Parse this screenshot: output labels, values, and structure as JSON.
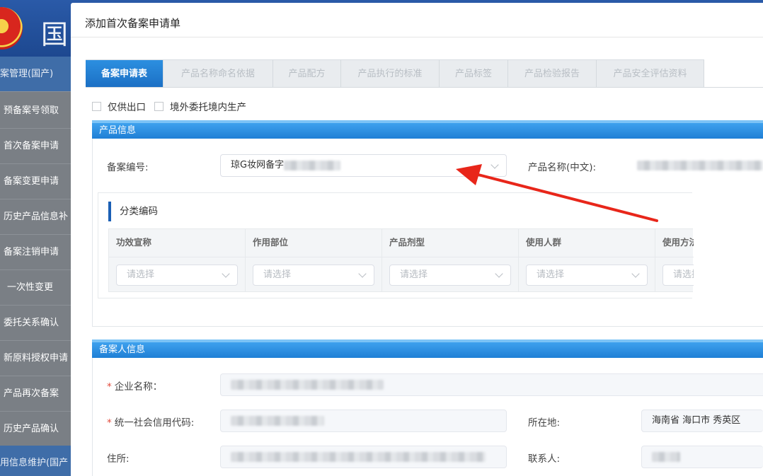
{
  "background": {
    "header_title": "国",
    "menu_group_top": "案管理(国产)",
    "menu_items": [
      "预备案号领取",
      "首次备案申请",
      "备案变更申请",
      "历史产品信息补",
      "备案注销申请",
      "一次性变更",
      "委托关系确认",
      "新原料授权申请",
      "产品再次备案",
      "历史产品确认"
    ],
    "menu_group_bottom": "用信息维护(国产"
  },
  "modal": {
    "title": "添加首次备案申请单",
    "tabs": [
      "备案申请表",
      "产品名称命名依据",
      "产品配方",
      "产品执行的标准",
      "产品标签",
      "产品检验报告",
      "产品安全评估资料"
    ],
    "active_tab": "备案申请表",
    "checkboxes": [
      {
        "label": "仅供出口",
        "checked": false
      },
      {
        "label": "境外委托境内生产",
        "checked": false
      }
    ],
    "product_info": {
      "heading": "产品信息",
      "filing_no_label": "备案编号:",
      "filing_no_value": "琼G妆网备字",
      "product_name_label": "产品名称(中文):",
      "classification": {
        "title": "分类编码",
        "columns": [
          {
            "header": "功效宣称",
            "placeholder": "请选择"
          },
          {
            "header": "作用部位",
            "placeholder": "请选择"
          },
          {
            "header": "产品剂型",
            "placeholder": "请选择"
          },
          {
            "header": "使用人群",
            "placeholder": "请选择"
          },
          {
            "header": "使用方法",
            "placeholder": "请选择"
          }
        ]
      }
    },
    "applicant_info": {
      "heading": "备案人信息",
      "company_name_label": "企业名称：",
      "credit_code_label": "统一社会信用代码:",
      "location_label": "所在地:",
      "location_value": "海南省 海口市 秀英区",
      "address_label": "住所:",
      "contact_label": "联系人:"
    }
  },
  "colors": {
    "accent": "#1f7fd5",
    "required": "#e24a3b",
    "annotation_arrow": "#e8261a"
  }
}
